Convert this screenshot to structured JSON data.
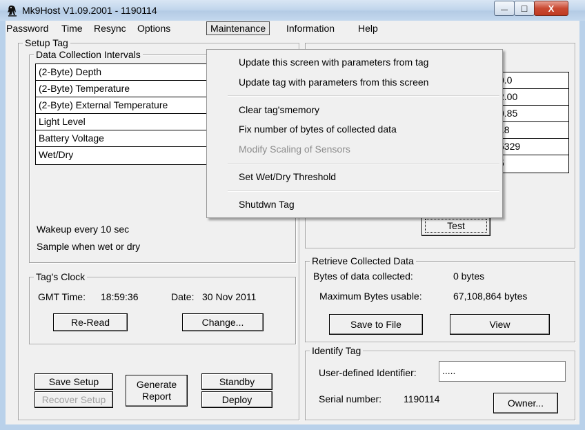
{
  "window": {
    "title": "Mk9Host V1.09.2001 - 1190114",
    "icon": "penguin-icon",
    "minimize_glyph": "—",
    "maximize_glyph": "□",
    "close_glyph": "X"
  },
  "menubar": {
    "items": [
      "Password",
      "Time",
      "Resync",
      "Options",
      "Maintenance",
      "Information",
      "Help"
    ],
    "active": "Maintenance"
  },
  "maintenance_menu": {
    "items": [
      {
        "label": "Update this screen with parameters from tag",
        "enabled": true
      },
      {
        "label": "Update tag with parameters from this screen",
        "enabled": true
      },
      {
        "label": "Clear tag'smemory",
        "enabled": true
      },
      {
        "label": "Fix number of bytes of collected data",
        "enabled": true
      },
      {
        "label": "Modify Scaling of Sensors",
        "enabled": false
      },
      {
        "label": "Set Wet/Dry Threshold",
        "enabled": true
      },
      {
        "label": "Shutdwn Tag",
        "enabled": true
      }
    ]
  },
  "setup_tag": {
    "title": "Setup Tag",
    "intervals": {
      "title": "Data Collection Intervals",
      "items": [
        "(2-Byte) Depth",
        "(2-Byte) Temperature",
        "(2-Byte) External Temperature",
        "Light Level",
        "Battery Voltage",
        "Wet/Dry"
      ]
    },
    "wakeup": "Wakeup every 10 sec",
    "sample": "Sample when wet or dry",
    "clock": {
      "title": "Tag's Clock",
      "gmt_label": "GMT Time:",
      "gmt_value": "18:59:36",
      "date_label": "Date:",
      "date_value": "30 Nov 2011",
      "reread": "Re-Read",
      "change": "Change..."
    },
    "buttons": {
      "save_setup": "Save Setup",
      "recover_setup": "Recover Setup",
      "generate_report": "Generate\nReport",
      "standby": "Standby",
      "deploy": "Deploy"
    }
  },
  "sensor_values": [
    "0.0",
    "2.00",
    "0.85",
    "18",
    "5329",
    "5"
  ],
  "test_button": "Test",
  "retrieve": {
    "title": "Retrieve Collected Data",
    "bytes_label": "Bytes of data collected:",
    "bytes_value": "0 bytes",
    "max_label": "Maximum Bytes usable:",
    "max_value": "67,108,864 bytes",
    "save_to_file": "Save to File",
    "view": "View"
  },
  "identify": {
    "title": "Identify Tag",
    "user_id_label": "User-defined Identifier:",
    "user_id_value": ".....",
    "serial_label": "Serial number:",
    "serial_value": "1190114",
    "owner": "Owner..."
  }
}
